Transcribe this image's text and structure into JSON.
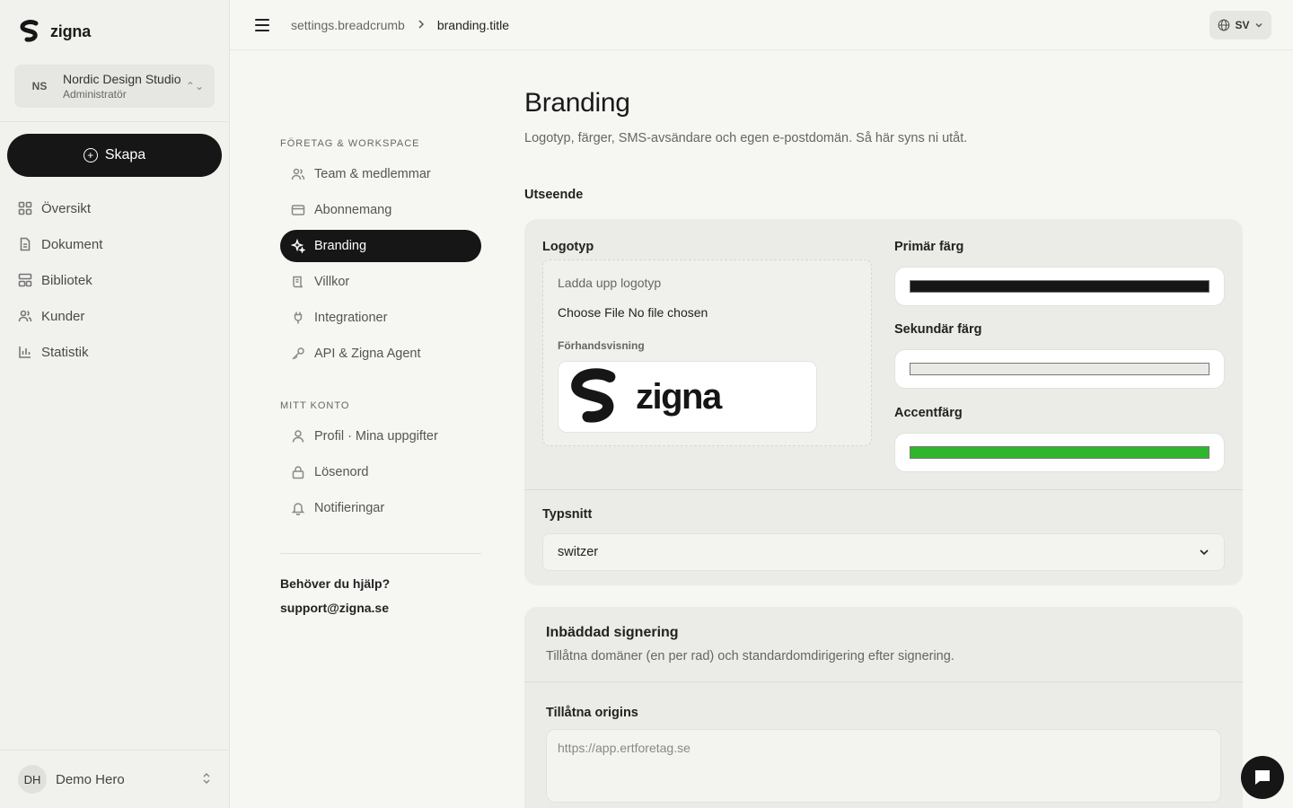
{
  "app": {
    "name": "zigna"
  },
  "workspace": {
    "initials": "NS",
    "name": "Nordic Design Studio",
    "role": "Administratör"
  },
  "sidebar": {
    "create_label": "Skapa",
    "items": [
      {
        "label": "Översikt",
        "icon": "grid-icon"
      },
      {
        "label": "Dokument",
        "icon": "document-icon"
      },
      {
        "label": "Bibliotek",
        "icon": "library-icon"
      },
      {
        "label": "Kunder",
        "icon": "users-icon"
      },
      {
        "label": "Statistik",
        "icon": "bar-chart-icon"
      }
    ],
    "user": {
      "initials": "DH",
      "name": "Demo Hero"
    }
  },
  "topbar": {
    "breadcrumb": "settings.breadcrumb",
    "current": "branding.title",
    "language": "SV"
  },
  "settings_nav": {
    "group1_heading": "FÖRETAG & WORKSPACE",
    "group1": [
      {
        "label": "Team & medlemmar",
        "icon": "users-icon"
      },
      {
        "label": "Abonnemang",
        "icon": "credit-card-icon"
      },
      {
        "label": "Branding",
        "icon": "sparkle-icon",
        "active": true
      },
      {
        "label": "Villkor",
        "icon": "scroll-icon"
      },
      {
        "label": "Integrationer",
        "icon": "plug-icon"
      },
      {
        "label": "API & Zigna Agent",
        "icon": "key-icon"
      }
    ],
    "group2_heading": "MITT KONTO",
    "group2": [
      {
        "label": "Profil · Mina uppgifter",
        "icon": "user-icon"
      },
      {
        "label": "Lösenord",
        "icon": "lock-icon"
      },
      {
        "label": "Notifieringar",
        "icon": "bell-icon"
      }
    ],
    "help_title": "Behöver du hjälp?",
    "help_email": "support@zigna.se"
  },
  "page": {
    "title": "Branding",
    "subtitle": "Logotyp, färger, SMS-avsändare och egen e-postdomän. Så här syns ni utåt.",
    "section_label": "Utseende"
  },
  "appearance": {
    "logo_label": "Logotyp",
    "upload_title": "Ladda upp logotyp",
    "file_input_text": "Choose File No file chosen",
    "preview_label": "Förhandsvisning",
    "preview_brand": "zigna",
    "primary_label": "Primär färg",
    "primary_color": "#161616",
    "secondary_label": "Sekundär färg",
    "secondary_color": "#e9e9e5",
    "accent_label": "Accentfärg",
    "accent_color": "#2eb62c",
    "font_label": "Typsnitt",
    "font_value": "switzer"
  },
  "embedded": {
    "title": "Inbäddad signering",
    "subtitle": "Tillåtna domäner (en per rad) och standardomdirigering efter signering.",
    "origins_label": "Tillåtna origins",
    "origins_placeholder": "https://app.ertforetag.se"
  }
}
